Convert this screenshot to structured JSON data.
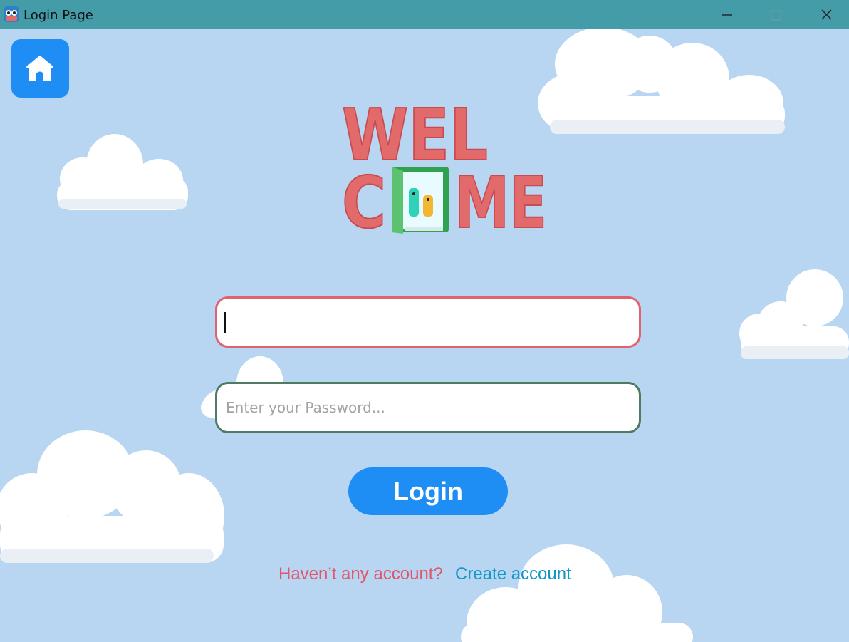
{
  "window": {
    "title": "Login Page",
    "colors": {
      "titlebar": "#449ca9",
      "background": "#b8d6f2"
    }
  },
  "titlebar_icons": [
    "app-icon",
    "minimize-icon",
    "maximize-icon",
    "close-icon"
  ],
  "home": {
    "icon": "home-icon",
    "color": "#1e8ef5"
  },
  "logo": {
    "text_line1": "WEL",
    "text_line2_left": "C",
    "text_line2_right": "ME",
    "text_color": "#e36a6a"
  },
  "form": {
    "username": {
      "value": "",
      "placeholder": "",
      "border_color": "#e0616f"
    },
    "password": {
      "value": "",
      "placeholder": "Enter your Password...",
      "border_color": "#4e7b63"
    },
    "login_label": "Login",
    "login_color": "#1e8ef5"
  },
  "footer": {
    "question": "Haven’t any account?",
    "create_link": "Create account",
    "question_color": "#e0566a",
    "link_color": "#1597c6"
  }
}
